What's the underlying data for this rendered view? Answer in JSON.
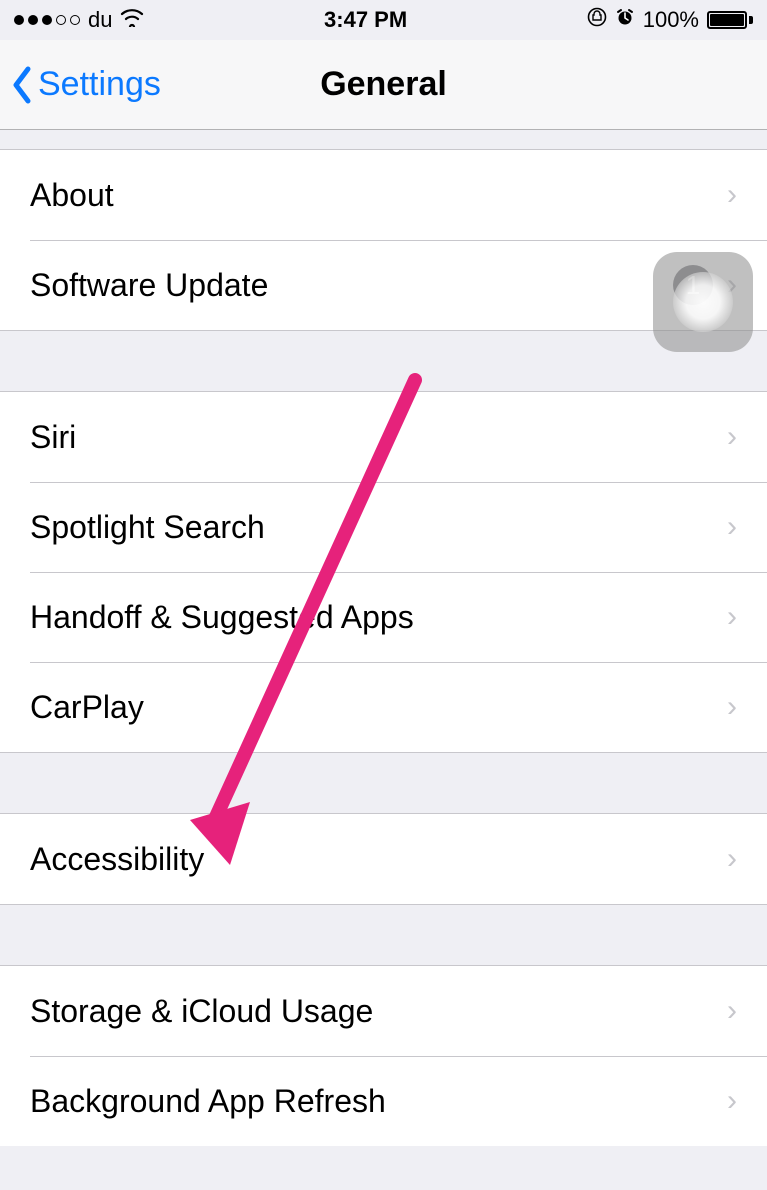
{
  "status": {
    "carrier": "du",
    "time": "3:47 PM",
    "battery_pct": "100%"
  },
  "nav": {
    "back_label": "Settings",
    "title": "General"
  },
  "sections": [
    {
      "rows": [
        {
          "label": "About"
        },
        {
          "label": "Software Update",
          "badge": "1"
        }
      ]
    },
    {
      "rows": [
        {
          "label": "Siri"
        },
        {
          "label": "Spotlight Search"
        },
        {
          "label": "Handoff & Suggested Apps"
        },
        {
          "label": "CarPlay"
        }
      ]
    },
    {
      "rows": [
        {
          "label": "Accessibility"
        }
      ]
    },
    {
      "rows": [
        {
          "label": "Storage & iCloud Usage"
        },
        {
          "label": "Background App Refresh"
        }
      ]
    }
  ],
  "annotation": {
    "arrow_color": "#e6227b"
  }
}
